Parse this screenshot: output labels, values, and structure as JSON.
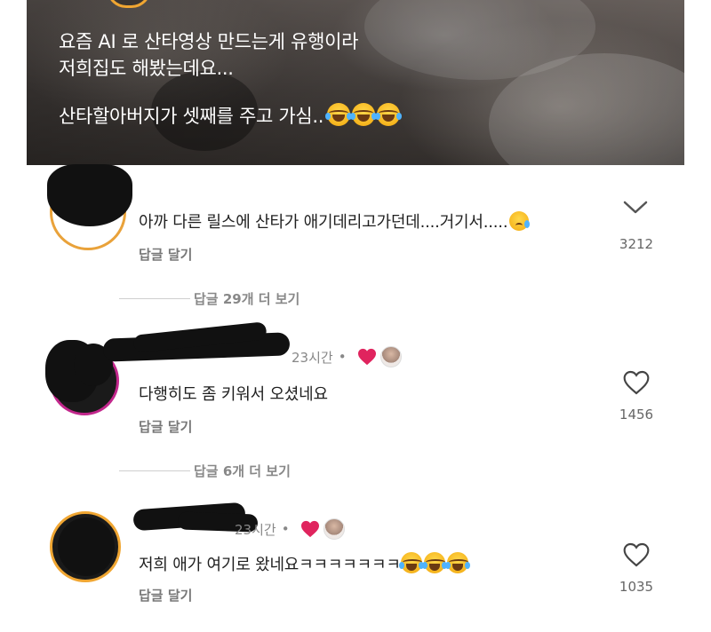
{
  "post": {
    "caption_line1": "요즘 AI 로 산타영상 만드는게 유행이라",
    "caption_line2": "저희집도 해봤는데요...",
    "caption_line3": "산타할아버지가 셋째를 주고 가심..",
    "caption_emoji": "face-with-tears-of-joy x3"
  },
  "comments": [
    {
      "text": "아까 다른 릴스에 산타가 애기데리고가던데....거기서.....",
      "text_emoji": "crying-face",
      "reply_label": "답글 달기",
      "side_icon": "chevron-down-icon",
      "count": "3212"
    },
    {
      "time": "23시간",
      "dot": "•",
      "text": "다행히도 좀 키워서 오셨네요",
      "reply_label": "답글 달기",
      "side_icon": "heart-outline-icon",
      "count": "1456"
    },
    {
      "time": "23시간",
      "dot": "•",
      "text": "저희 애가 여기로 왔네요ㅋㅋㅋㅋㅋㅋㅋ",
      "text_emoji": "face-with-tears-of-joy x3",
      "reply_label": "답글 달기",
      "side_icon": "heart-outline-icon",
      "count": "1035"
    }
  ],
  "more_replies": [
    {
      "label": "답글 29개 더 보기"
    },
    {
      "label": "답글 6개 더 보기"
    }
  ],
  "colors": {
    "liked_heart": "#e0245e",
    "ring_orange": "#f0a632",
    "ring_magenta": "#c2278c",
    "muted_text": "#888888"
  }
}
